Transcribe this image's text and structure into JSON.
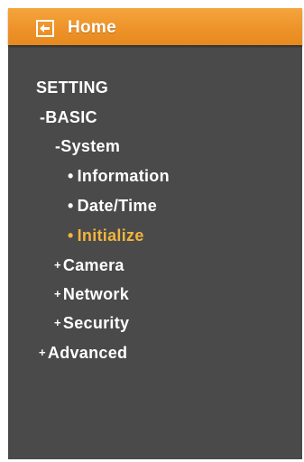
{
  "header": {
    "home_label": "Home",
    "icon": "back-arrow-icon",
    "accent_color": "#ee9329"
  },
  "menu": {
    "section_title": "SETTING",
    "items": [
      {
        "marker": "-",
        "label": "BASIC",
        "state": "expanded"
      },
      {
        "marker": "-",
        "label": "System",
        "state": "expanded"
      },
      {
        "marker": "•",
        "label": "Information"
      },
      {
        "marker": "•",
        "label": "Date/Time"
      },
      {
        "marker": "•",
        "label": "Initialize",
        "state": "selected"
      },
      {
        "marker": "+",
        "label": "Camera",
        "state": "collapsed"
      },
      {
        "marker": "+",
        "label": "Network",
        "state": "collapsed"
      },
      {
        "marker": "+",
        "label": "Security",
        "state": "collapsed"
      },
      {
        "marker": "+",
        "label": "Advanced",
        "state": "collapsed"
      }
    ]
  },
  "colors": {
    "panel_background": "#4a4a4a",
    "text": "#ffffff",
    "selected_text": "#f2b53c"
  }
}
